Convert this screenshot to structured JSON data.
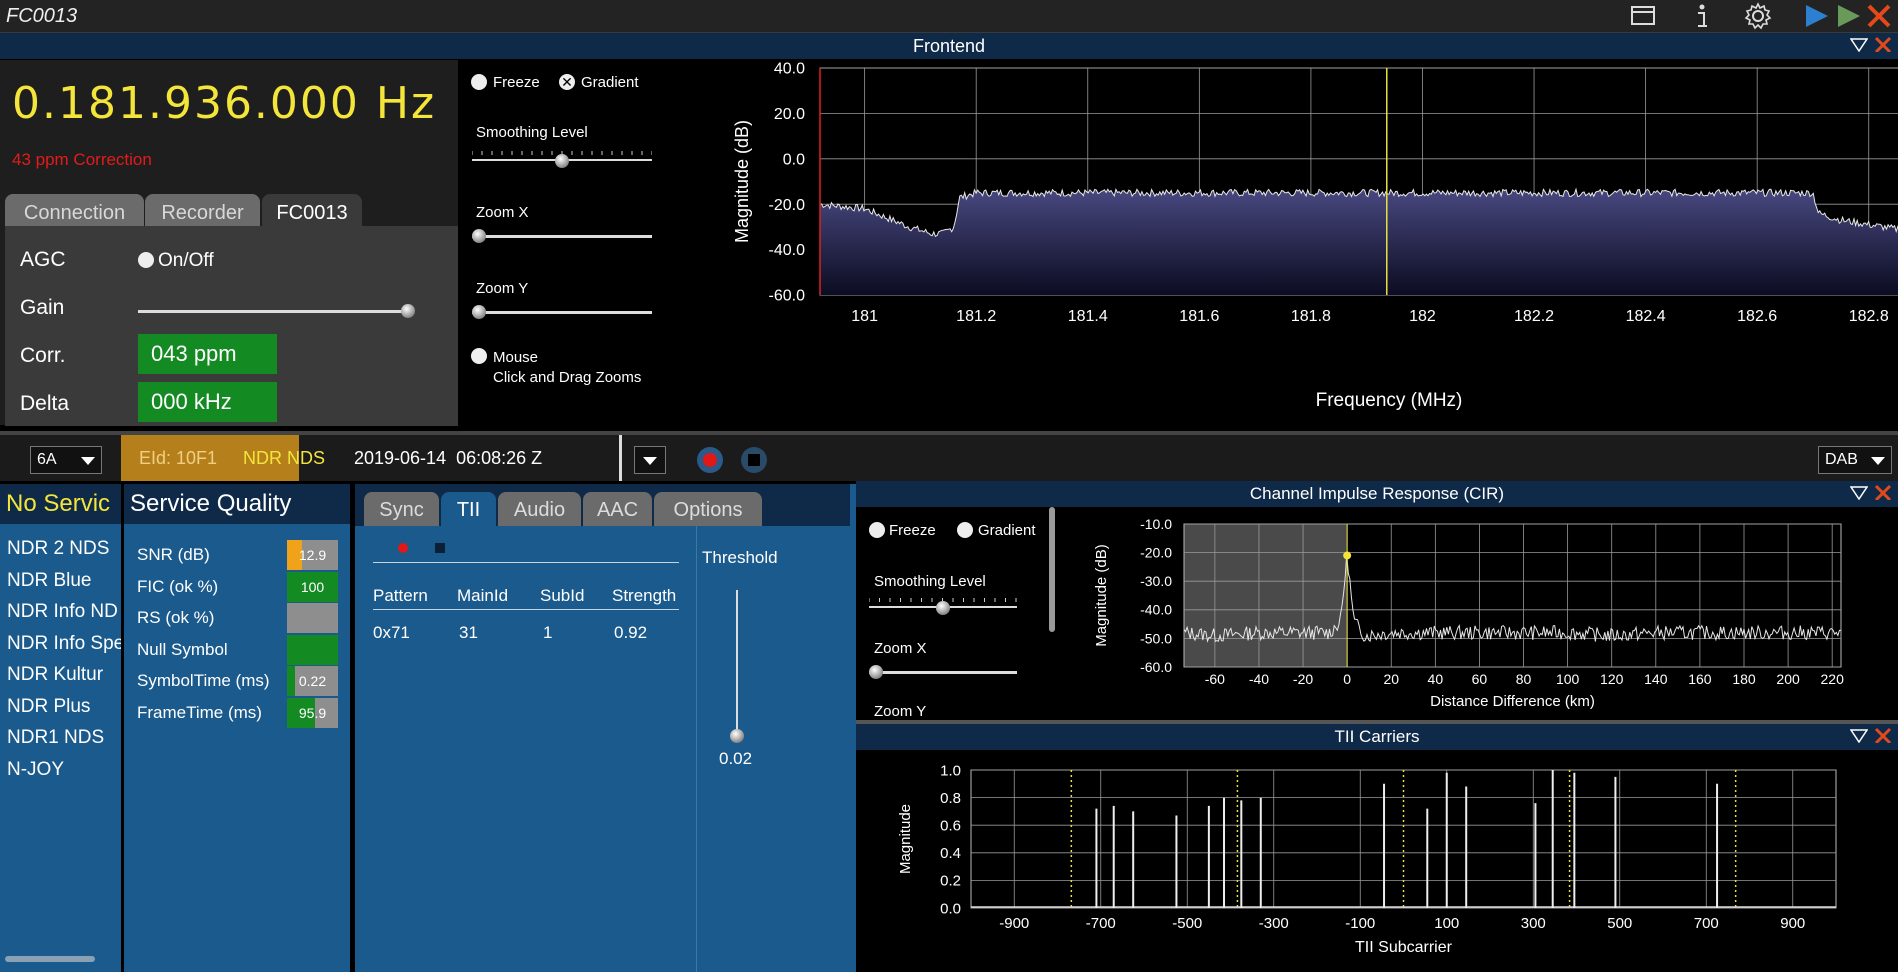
{
  "window": {
    "title": "FC0013"
  },
  "colors": {
    "accent_yellow": "#f3e53a",
    "green": "#138a22",
    "orange": "#f0a21b",
    "panel_blue": "#1b5a8c",
    "header_blue": "#0f2a48",
    "close_red": "#e24a1b"
  },
  "frontend": {
    "header": "Frontend",
    "frequency": "0.181.936.000",
    "frequency_unit": "Hz",
    "ppm_correction": "43 ppm Correction",
    "tabs": [
      {
        "label": "Connection"
      },
      {
        "label": "Recorder"
      },
      {
        "label": "FC0013"
      }
    ],
    "agc_label": "AGC",
    "agc_toggle": "On/Off",
    "gain_label": "Gain",
    "gain_level": 1.0,
    "corr_label": "Corr.",
    "corr_value": "043 ppm",
    "delta_label": "Delta",
    "delta_value": "000 kHz",
    "freeze_label": "Freeze",
    "gradient_label": "Gradient",
    "smoothing_label": "Smoothing Level",
    "smoothing_level": 0.5,
    "zoomx_label": "Zoom X",
    "zoomx_level": 0.0,
    "zoomy_label": "Zoom Y",
    "zoomy_level": 0.0,
    "mouse_label": "Mouse",
    "mouse_hint": "Click and Drag Zooms"
  },
  "status_bar": {
    "channel": "6A",
    "eid": "EId: 10F1",
    "ensemble": "NDR NDS",
    "datetime": "2019-06-14  06:08:26 Z",
    "mode": "DAB"
  },
  "services": {
    "header": "No Servic",
    "items": [
      "NDR 2 NDS",
      "NDR Blue",
      "NDR Info ND",
      "NDR Info Spe",
      "NDR Kultur",
      "NDR Plus",
      "NDR1 NDS",
      "N-JOY"
    ]
  },
  "quality": {
    "header": "Service Quality",
    "items": [
      {
        "label": "SNR (dB)",
        "value": "12.9",
        "fill": 0.3,
        "color": "#f0a21b"
      },
      {
        "label": "FIC (ok %)",
        "value": "100",
        "fill": 1.0,
        "color": "#138a22"
      },
      {
        "label": "RS (ok %)",
        "value": "",
        "fill": 0.0,
        "color": "#8e8e8e"
      },
      {
        "label": "Null Symbol",
        "value": "",
        "fill": 1.0,
        "color": "#138a22"
      },
      {
        "label": "SymbolTime (ms)",
        "value": "0.22",
        "fill": 0.15,
        "color": "#138a22"
      },
      {
        "label": "FrameTime (ms)",
        "value": "95.9",
        "fill": 0.55,
        "color": "#138a22"
      }
    ]
  },
  "tii": {
    "tabs": [
      {
        "label": "Sync"
      },
      {
        "label": "TII"
      },
      {
        "label": "Audio"
      },
      {
        "label": "AAC"
      },
      {
        "label": "Options"
      }
    ],
    "columns": [
      "Pattern",
      "MainId",
      "SubId",
      "Strength"
    ],
    "rows": [
      [
        "0x71",
        "31",
        "1",
        "0.92"
      ]
    ],
    "threshold_label": "Threshold",
    "threshold_value": "0.02",
    "threshold_level": 0.02
  },
  "cir": {
    "header": "Channel Impulse Response (CIR)",
    "freeze_label": "Freeze",
    "gradient_label": "Gradient",
    "smoothing_label": "Smoothing Level",
    "zoomx_label": "Zoom X",
    "zoomy_label": "Zoom Y"
  },
  "tii_carriers": {
    "header": "TII Carriers"
  },
  "chart_data": [
    {
      "type": "area",
      "xlabel": "Frequency (MHz)",
      "ylabel": "Magnitude (dB)",
      "xlim": [
        180.92,
        182.96
      ],
      "ylim": [
        -60,
        40
      ],
      "xticks": [
        "181",
        "181.2",
        "181.4",
        "181.6",
        "181.8",
        "182",
        "182.2",
        "182.4",
        "182.6",
        "182.8"
      ],
      "xtick_values": [
        181,
        181.2,
        181.4,
        181.6,
        181.8,
        182,
        182.2,
        182.4,
        182.6,
        182.8
      ],
      "yticks": [
        "40.0",
        "20.0",
        "0.0",
        "-20.0",
        "-40.0",
        "-60.0"
      ],
      "ytick_values": [
        40,
        20,
        0,
        -20,
        -40,
        -60
      ],
      "marker_x": 181.936,
      "grid": true,
      "x": [
        180.92,
        180.96,
        181.0,
        181.04,
        181.08,
        181.12,
        181.14,
        181.16,
        181.17,
        181.2,
        181.4,
        181.6,
        181.8,
        182.0,
        182.2,
        182.4,
        182.6,
        182.7,
        182.71,
        182.75,
        182.8,
        182.85,
        182.87,
        182.88,
        182.96
      ],
      "values": [
        -20,
        -21,
        -22,
        -26,
        -30,
        -33,
        -33,
        -30,
        -17,
        -15,
        -15,
        -15,
        -15,
        -15,
        -15,
        -15,
        -15,
        -15,
        -24,
        -27,
        -29,
        -31,
        -28,
        -14,
        -15
      ]
    },
    {
      "type": "line",
      "xlabel": "Distance Difference (km)",
      "ylabel": "Magnitude (dB)",
      "xlim": [
        -74,
        224
      ],
      "ylim": [
        -60,
        -10
      ],
      "xticks": [
        "-60",
        "-40",
        "-20",
        "0",
        "20",
        "40",
        "60",
        "80",
        "100",
        "120",
        "140",
        "160",
        "180",
        "200",
        "220"
      ],
      "xtick_values": [
        -60,
        -40,
        -20,
        0,
        20,
        40,
        60,
        80,
        100,
        120,
        140,
        160,
        180,
        200,
        220
      ],
      "yticks": [
        "-10.0",
        "-20.0",
        "-30.0",
        "-40.0",
        "-50.0",
        "-60.0"
      ],
      "ytick_values": [
        -10,
        -20,
        -30,
        -40,
        -50,
        -60
      ],
      "peak": {
        "x": 0,
        "y": -21
      },
      "grid": true,
      "x": [
        -74,
        -60,
        -40,
        -20,
        -8,
        -3,
        0,
        3,
        8,
        20,
        40,
        60,
        80,
        100,
        120,
        140,
        160,
        180,
        200,
        224
      ],
      "values": [
        -48,
        -49,
        -48,
        -48,
        -48,
        -44,
        -21,
        -44,
        -49,
        -48,
        -48,
        -48,
        -48,
        -48,
        -49,
        -48,
        -48,
        -48,
        -48,
        -48
      ]
    },
    {
      "type": "bar",
      "xlabel": "TII Subcarrier",
      "ylabel": "Magnitude",
      "xlim": [
        -1000,
        1000
      ],
      "ylim": [
        0,
        1.0
      ],
      "xticks": [
        "-900",
        "-700",
        "-500",
        "-300",
        "-100",
        "100",
        "300",
        "500",
        "700",
        "900"
      ],
      "xtick_values": [
        -900,
        -700,
        -500,
        -300,
        -100,
        100,
        300,
        500,
        700,
        900
      ],
      "yticks": [
        "1.0",
        "0.8",
        "0.6",
        "0.4",
        "0.2",
        "0.0"
      ],
      "ytick_values": [
        1.0,
        0.8,
        0.6,
        0.4,
        0.2,
        0.0
      ],
      "dotted_lines_x": [
        -768,
        -384,
        0,
        384,
        768
      ],
      "grid": true,
      "x": [
        -710,
        -670,
        -625,
        -525,
        -450,
        -415,
        -375,
        -330,
        -45,
        55,
        100,
        145,
        305,
        345,
        395,
        490,
        725
      ],
      "values": [
        0.72,
        0.74,
        0.7,
        0.67,
        0.74,
        0.8,
        0.78,
        0.8,
        0.9,
        0.72,
        0.98,
        0.88,
        0.76,
        1.0,
        0.98,
        0.95,
        0.9
      ]
    }
  ]
}
